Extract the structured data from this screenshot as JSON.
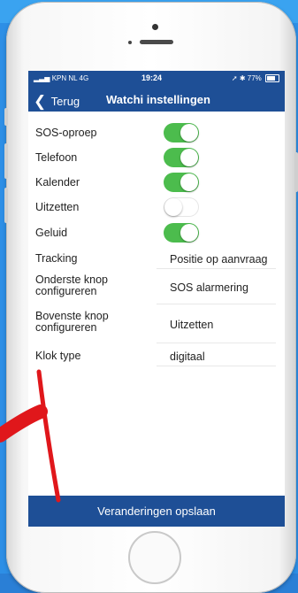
{
  "statusbar": {
    "carrier": "KPN NL 4G",
    "time": "19:24",
    "battery": "77%"
  },
  "navbar": {
    "back_label": "Terug",
    "title": "Watchi instellingen"
  },
  "settings": {
    "sos": {
      "label": "SOS-oproep",
      "enabled": true
    },
    "telefoon": {
      "label": "Telefoon",
      "enabled": true
    },
    "kalender": {
      "label": "Kalender",
      "enabled": true
    },
    "uitzetten": {
      "label": "Uitzetten",
      "enabled": false
    },
    "geluid": {
      "label": "Geluid",
      "enabled": true
    },
    "tracking": {
      "label": "Tracking",
      "value": "Positie op aanvraag"
    },
    "onderste": {
      "label_line1": "Onderste knop",
      "label_line2": "configureren",
      "value": "SOS alarmering"
    },
    "bovenste": {
      "label_line1": "Bovenste knop",
      "label_line2": "configureren",
      "value": "Uitzetten"
    },
    "klok": {
      "label": "Klok type",
      "value": "digitaal"
    }
  },
  "save_button": {
    "label": "Veranderingen opslaan"
  },
  "colors": {
    "nav_blue": "#1e4f96",
    "toggle_green": "#4cbc4d",
    "background_blue": "#2d8fe6",
    "arrow_red": "#e0171b"
  }
}
